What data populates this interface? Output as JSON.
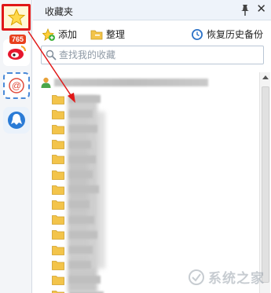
{
  "header": {
    "title": "收藏夹"
  },
  "toolbar": {
    "add_label": "添加",
    "organize_label": "整理",
    "restore_label": "恢复历史备份"
  },
  "search": {
    "placeholder": "查找我的收藏",
    "value": ""
  },
  "rail": {
    "weibo_badge": "765"
  },
  "tree": {
    "folders": [
      {
        "label_width": 40
      },
      {
        "label_width": 30
      },
      {
        "label_width": 36
      },
      {
        "label_width": 28
      },
      {
        "label_width": 34
      },
      {
        "label_width": 30
      },
      {
        "label_width": 38
      },
      {
        "label_width": 26
      },
      {
        "label_width": 32
      },
      {
        "label_width": 36
      },
      {
        "label_width": 30
      },
      {
        "label_width": 28
      },
      {
        "label_width": 40
      },
      {
        "label_width": 44
      }
    ]
  },
  "watermark": {
    "text": "系统之家"
  },
  "colors": {
    "annotation": "#e01818",
    "header_bg": "#eef3fa",
    "folder": "#f3c44a"
  },
  "icons": [
    "star-icon",
    "weibo-icon",
    "mail-at-icon",
    "qq-icon",
    "pin-icon",
    "close-icon",
    "add-icon",
    "organize-folder-icon",
    "clock-restore-icon",
    "search-icon",
    "user-icon",
    "folder-icon",
    "scroll-up-icon"
  ]
}
